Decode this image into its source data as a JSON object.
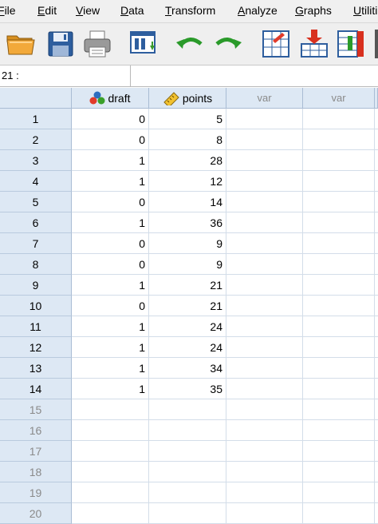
{
  "menu": {
    "file": "File",
    "edit": "Edit",
    "view": "View",
    "data": "Data",
    "transform": "Transform",
    "analyze": "Analyze",
    "graphs": "Graphs",
    "utilities": "Utiliti"
  },
  "toolbar": {
    "icons": [
      "open-folder-icon",
      "save-icon",
      "print-icon",
      "dialog-recall-icon",
      "undo-icon",
      "redo-icon",
      "goto-case-icon",
      "insert-cases-icon",
      "insert-variable-icon"
    ]
  },
  "cell_ref": "21 :",
  "columns": [
    {
      "label": "draft",
      "type": "nominal"
    },
    {
      "label": "points",
      "type": "scale"
    },
    {
      "label": "var",
      "type": "empty"
    },
    {
      "label": "var",
      "type": "empty"
    }
  ],
  "rows": [
    {
      "num": "1",
      "draft": "0",
      "points": "5"
    },
    {
      "num": "2",
      "draft": "0",
      "points": "8"
    },
    {
      "num": "3",
      "draft": "1",
      "points": "28"
    },
    {
      "num": "4",
      "draft": "1",
      "points": "12"
    },
    {
      "num": "5",
      "draft": "0",
      "points": "14"
    },
    {
      "num": "6",
      "draft": "1",
      "points": "36"
    },
    {
      "num": "7",
      "draft": "0",
      "points": "9"
    },
    {
      "num": "8",
      "draft": "0",
      "points": "9"
    },
    {
      "num": "9",
      "draft": "1",
      "points": "21"
    },
    {
      "num": "10",
      "draft": "0",
      "points": "21"
    },
    {
      "num": "11",
      "draft": "1",
      "points": "24"
    },
    {
      "num": "12",
      "draft": "1",
      "points": "24"
    },
    {
      "num": "13",
      "draft": "1",
      "points": "34"
    },
    {
      "num": "14",
      "draft": "1",
      "points": "35"
    },
    {
      "num": "15",
      "draft": "",
      "points": ""
    },
    {
      "num": "16",
      "draft": "",
      "points": ""
    },
    {
      "num": "17",
      "draft": "",
      "points": ""
    },
    {
      "num": "18",
      "draft": "",
      "points": ""
    },
    {
      "num": "19",
      "draft": "",
      "points": ""
    },
    {
      "num": "20",
      "draft": "",
      "points": ""
    }
  ],
  "colors": {
    "header_bg": "#dde8f4",
    "grid_line": "#d3dde9",
    "empty_text": "#8a8a8a"
  }
}
